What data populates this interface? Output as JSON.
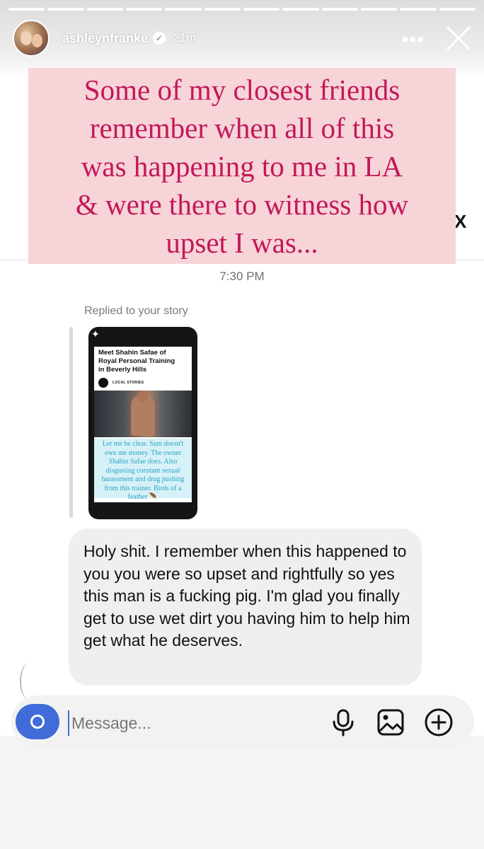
{
  "story": {
    "username": "ashleynfranke",
    "time_ago": "21m",
    "verified_glyph": "✓",
    "more_label": "•••",
    "progress_segments": 12
  },
  "overlay": {
    "text": "Some of my closest friends\nremember when all of this\nwas happening to me in LA\n& were there to witness how\nupset I was...",
    "edge_glyph": "X",
    "color": "#c2185b",
    "background": "#f7d3d6"
  },
  "chat": {
    "timestamp": "7:30 PM",
    "replied_label": "Replied to your story",
    "story_thumb": {
      "title": "Meet Shahin Safae of\nRoyal Personal Training\nin Beverly Hills",
      "category": "LOCAL STORIES",
      "caption": "Let me be clear. Sam doesn't owe me money. The owner Shahin Safae does. Also disgusting constant sexual harassment and drug pushing from this trainer. Birds of a feather 🪶"
    },
    "message": "Holy shit. I remember when this happened to you you were so upset and rightfully so yes this man is a fucking pig. I'm glad you finally get to use wet dirt you having him to help him get what he deserves."
  },
  "composer": {
    "placeholder": "Message...",
    "icons": [
      "camera-icon",
      "microphone-icon",
      "image-icon",
      "add-icon"
    ],
    "camera_color": "#3f6cd8"
  }
}
